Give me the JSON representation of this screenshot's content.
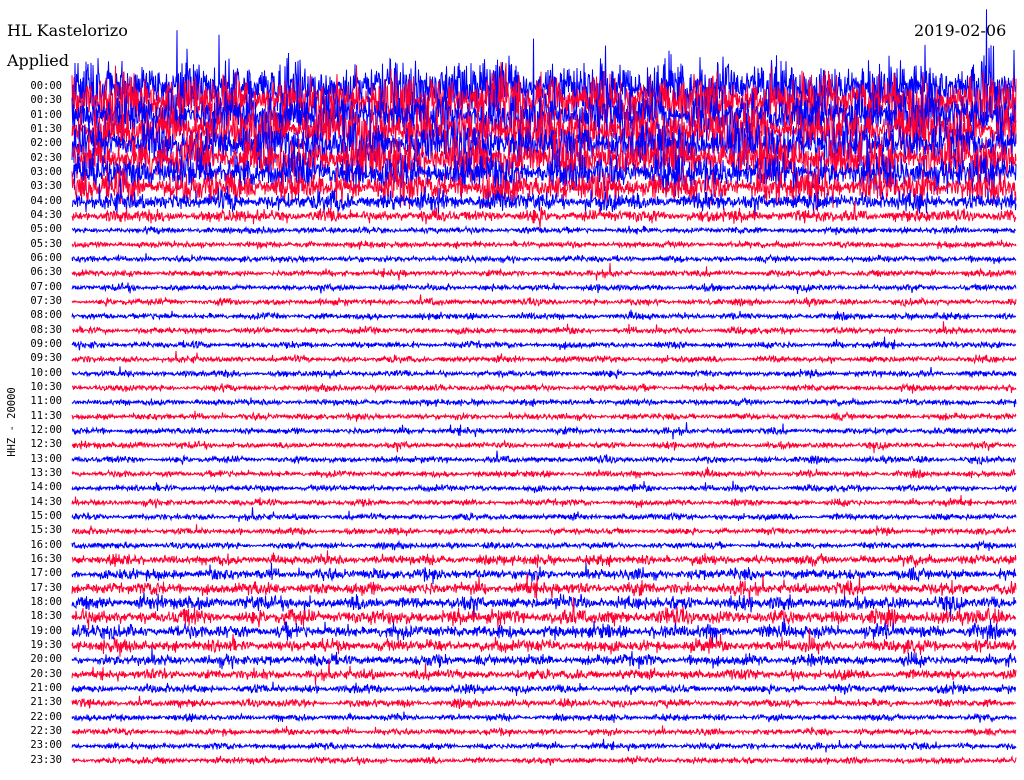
{
  "header": {
    "station": "HL Kastelorizo",
    "filter": "Applied",
    "date": "2019-02-06"
  },
  "y_axis_label": "HHZ - 20000",
  "colors": {
    "trace_a": "#0000ff",
    "trace_b": "#ff0033"
  },
  "chart_data": {
    "type": "line",
    "title": "HL Kastelorizo",
    "ylabel": "HHZ - 20000",
    "time_labels": [
      "00:00",
      "00:30",
      "01:00",
      "01:30",
      "02:00",
      "02:30",
      "03:00",
      "03:30",
      "04:00",
      "04:30",
      "05:00",
      "05:30",
      "06:00",
      "06:30",
      "07:00",
      "07:30",
      "08:00",
      "08:30",
      "09:00",
      "09:30",
      "10:00",
      "10:30",
      "11:00",
      "11:30",
      "12:00",
      "12:30",
      "13:00",
      "13:30",
      "14:00",
      "14:30",
      "15:00",
      "15:30",
      "16:00",
      "16:30",
      "17:00",
      "17:30",
      "18:00",
      "18:30",
      "19:00",
      "19:30",
      "20:00",
      "20:30",
      "21:00",
      "21:30",
      "22:00",
      "22:30",
      "23:00",
      "23:30"
    ],
    "relative_amplitude": [
      9,
      9,
      8,
      8,
      7,
      7,
      6,
      5,
      3,
      2,
      1,
      1,
      1,
      1,
      1,
      1,
      1,
      1,
      1,
      1,
      1,
      1,
      1,
      1,
      1,
      1,
      1,
      1,
      1,
      1,
      1,
      1,
      1,
      1.6,
      1.8,
      2,
      2.2,
      2.4,
      2.2,
      2,
      1.8,
      1.6,
      1.3,
      1.2,
      1,
      1,
      1,
      1
    ]
  }
}
